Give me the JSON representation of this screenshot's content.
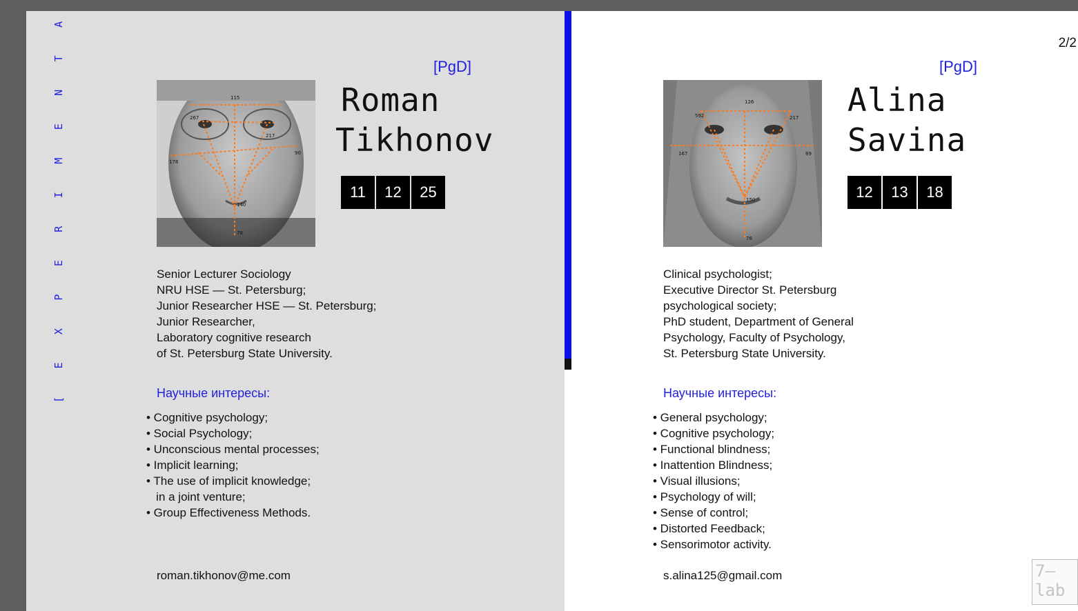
{
  "page_number": "2/2",
  "side_label": "[ E X P E R I M E N T A T O R S ]",
  "profiles": [
    {
      "tag": "[PgD]",
      "first_name": "Roman",
      "last_name": "Tikhonov",
      "codes": [
        "11",
        "12",
        "25"
      ],
      "photo_labels": [
        "115",
        "267",
        "217",
        "178",
        "90",
        "140",
        "78"
      ],
      "bio": "Senior Lecturer Sociology\nNRU HSE — St. Petersburg;\nJunior Researcher HSE — St. Petersburg;\nJunior Researcher,\nLaboratory cognitive research\nof St. Petersburg State University.",
      "interests_heading": "Научные интересы:",
      "interests": [
        "• Cognitive psychology;",
        "• Social Psychology;",
        "• Unconscious mental processes;",
        "• Implicit learning;",
        "• The use of implicit knowledge;",
        "   in a joint venture;",
        "• Group Effectiveness Methods."
      ],
      "email": "roman.tikhonov@me.com"
    },
    {
      "tag": "[PgD]",
      "first_name": "Alina",
      "last_name": "Savina",
      "codes": [
        "12",
        "13",
        "18"
      ],
      "photo_labels": [
        "126",
        "592",
        "217",
        "167",
        "89",
        "150",
        "76"
      ],
      "bio": "Clinical psychologist;\nExecutive Director St. Petersburg\npsychological society;\nPhD student, Department of General\nPsychology, Faculty of Psychology,\nSt. Petersburg State University.",
      "interests_heading": "Научные интересы:",
      "interests": [
        "• General psychology;",
        "• Cognitive psychology;",
        "• Functional blindness;",
        "• Inattention Blindness;",
        "• Visual illusions;",
        "• Psychology of will;",
        "• Sense of control;",
        "• Distorted Feedback;",
        "• Sensorimotor activity."
      ],
      "email": "s.alina125@gmail.com"
    }
  ],
  "logo": {
    "line1": "7—",
    "line2": "lab"
  },
  "colors": {
    "accent": "#1f1fe0",
    "left_bg": "#dedede",
    "right_bg": "#ffffff",
    "frame": "#5e5e5e",
    "measure": "#ff7a1a"
  }
}
